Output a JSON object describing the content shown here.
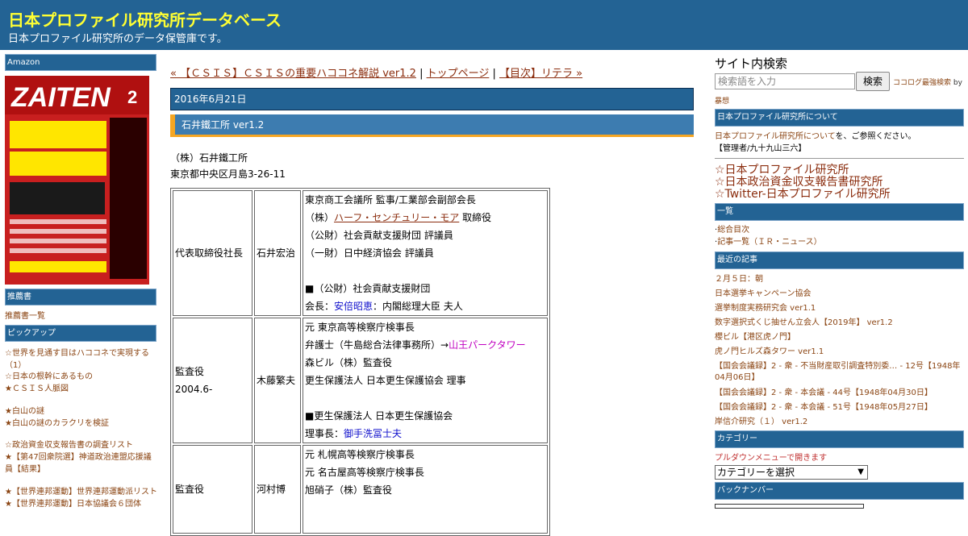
{
  "header": {
    "title": "日本プロファイル研究所データベース",
    "description": "日本プロファイル研究所のデータ保管庫です。"
  },
  "left_sidebar": {
    "amazon_heading": "Amazon",
    "ad": {
      "magazine": "ZAITEN",
      "issue": "2"
    },
    "recommend_heading": "推薦書",
    "recommend_link": "推薦書一覧",
    "pickup_heading": "ピックアップ",
    "pickup_links": [
      "☆世界を見通す目はハココネで実現する（1）",
      "☆日本の根幹にあるもの",
      "★ＣＳＩＳ人脈図",
      "★白山の謎",
      "★白山の謎のカラクリを検証",
      "☆政治資金収支報告書の調査リスト",
      "★【第47回衆院選】神道政治連盟応援議員【結果】",
      "★【世界連邦運動】世界連邦運動派リスト",
      "★【世界連邦運動】日本協議会６団体"
    ]
  },
  "nav": {
    "prev": "« 【ＣＳＩＳ】ＣＳＩＳの重要ハココネ解説 ver1.2",
    "sep1": " | ",
    "top": "トップページ",
    "sep2": " | ",
    "next": "【目次】リテラ »"
  },
  "entry": {
    "date": "2016年6月21日",
    "title": "石井鐵工所 ver1.2",
    "company_name": "（株）石井鐵工所",
    "address": "東京都中央区月島3-26-11",
    "rows": [
      {
        "role": "代表取締役社長",
        "role2": "",
        "name": "石井宏治",
        "d1": "東京商工会議所 監事/工業部会副部会長",
        "d2_pre": "（株）",
        "d2_link": "ハーフ・センチュリー・モア",
        "d2_post": " 取締役",
        "d3": "（公財）社会貢献支援財団 評議員",
        "d4": "（一財）日中経済協会 評議員",
        "d5": "■（公財）社会貢献支援財団",
        "d6_pre": "会長：",
        "d6_link": "安倍昭恵",
        "d6_post": "：内閣総理大臣 夫人"
      },
      {
        "role": "監査役",
        "role2": "2004.6-",
        "name": "木藤繁夫",
        "d1": "元 東京高等検察庁検事長",
        "d2_pre": "弁護士（牛島総合法律事務所）→",
        "d2_link": "山王パークタワー",
        "d3": "森ビル（株）監査役",
        "d4": "更生保護法人 日本更生保護協会 理事",
        "d5": "■更生保護法人 日本更生保護協会",
        "d6_pre": "理事長：",
        "d6_link": "御手洗冨士夫"
      },
      {
        "role": "監査役",
        "name": "河村博",
        "d1": "元 札幌高等検察庁検事長",
        "d2": "元 名古屋高等検察庁検事長",
        "d3": "旭硝子（株）監査役"
      }
    ]
  },
  "right_sidebar": {
    "search_title": "サイト内検索",
    "search_placeholder": "検索語を入力",
    "search_button": "検索",
    "cocolog": "ココログ最強検索",
    "by": " by",
    "bou": "暴想",
    "about_heading": "日本プロファイル研究所について",
    "about_link": "日本プロファイル研究所について",
    "about_text": "を、ご参照ください。",
    "admin": "【管理者/九十九山三六】",
    "big_links": [
      "☆日本プロファイル研究所",
      "☆日本政治資金収支報告書研究所",
      "☆Twitter-日本プロファイル研究所"
    ],
    "list_heading": "一覧",
    "list_links": [
      "総合目次",
      "記事一覧（ＩＲ・ニュース）"
    ],
    "recent_heading": "最近の記事",
    "recent_links": [
      "２月５日：朝",
      "日本選挙キャンペーン協会",
      "選挙制度実務研究会 ver1.1",
      "数字選択式くじ抽せん立会人【2019年】 ver1.2",
      "櫻ビル【港区虎ノ門】",
      "虎ノ門ヒルズ森タワー ver1.1",
      "【国会会議録】2 - 衆 - 不当財産取引調査特別委… - 12号【1948年04月06日】",
      "【国会会議録】2 - 衆 - 本会議 - 44号【1948年04月30日】",
      "【国会会議録】2 - 衆 - 本会議 - 51号【1948年05月27日】",
      "岸信介研究（１） ver1.2"
    ],
    "category_heading": "カテゴリー",
    "category_note": "プルダウンメニューで開きます",
    "category_select": "カテゴリーを選択",
    "backnumber_heading": "バックナンバー"
  },
  "colors": {
    "header_bg": "#236394",
    "title_yellow": "#ffff33",
    "accent_orange": "#f5a623",
    "link_brown": "#8b4513"
  }
}
